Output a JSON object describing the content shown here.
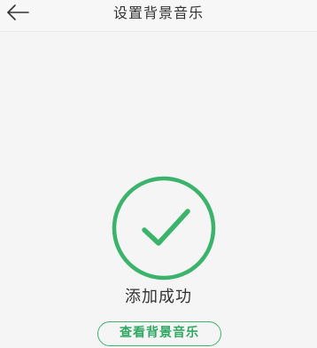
{
  "header": {
    "title": "设置背景音乐",
    "back_icon": "back-arrow-icon"
  },
  "result": {
    "icon": "check-circle-icon",
    "status_text": "添加成功",
    "action_label": "查看背景音乐"
  },
  "colors": {
    "accent": "#3bb36b",
    "background": "#f5f5f5",
    "text": "#333333"
  }
}
